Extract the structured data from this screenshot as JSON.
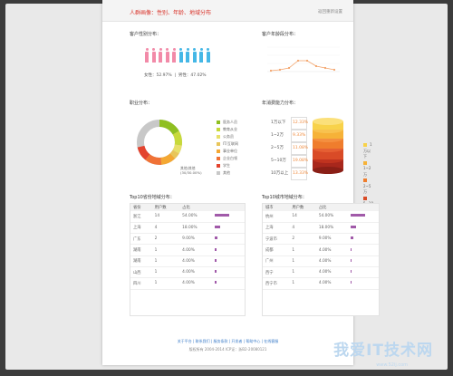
{
  "header": {
    "title": "人群画像：性别、年龄、地域分布",
    "action": "返回重新设置"
  },
  "gender": {
    "title": "客户性别分布：",
    "female_label": "女性：",
    "female_pct": "52.97%",
    "male_label": "男性：",
    "male_pct": "47.02%",
    "female_count": 5,
    "male_count": 5
  },
  "age": {
    "title": "客户年龄段分布："
  },
  "job": {
    "title": "职业分布：",
    "center_label": "其他/其他",
    "center_sub": "(30/30.00%)",
    "items": [
      {
        "label": "医务人员",
        "color": "#8fbf21"
      },
      {
        "label": "教育从业",
        "color": "#c7d93a"
      },
      {
        "label": "公务员",
        "color": "#e8e06a"
      },
      {
        "label": "IT/互联网",
        "color": "#e8c55a"
      },
      {
        "label": "事业单位",
        "color": "#f4a833"
      },
      {
        "label": "企业白领",
        "color": "#f07236"
      },
      {
        "label": "学生",
        "color": "#e3432e"
      },
      {
        "label": "其他",
        "color": "#c8c8c8"
      }
    ]
  },
  "income": {
    "title": "年消费能力分布：",
    "rows": [
      {
        "label": "1万以下",
        "pct": "12.33%",
        "color": "#f8d24a"
      },
      {
        "label": "1~2万",
        "pct": "9.33%",
        "color": "#f6b238"
      },
      {
        "label": "2~5万",
        "pct": "11.08%",
        "color": "#ef7d2d"
      },
      {
        "label": "5~10万",
        "pct": "19.08%",
        "color": "#d94b27"
      },
      {
        "label": "10万以上",
        "pct": "13.33%",
        "color": "#a8271c"
      }
    ]
  },
  "prov": {
    "title": "Top10省份地域分布：",
    "headers": [
      "省份",
      "用户数",
      "占比"
    ],
    "rows": [
      {
        "name": "浙江",
        "count": "14",
        "pct": "54.00%",
        "bar": 18
      },
      {
        "name": "上海",
        "count": "4",
        "pct": "18.00%",
        "bar": 7
      },
      {
        "name": "广东",
        "count": "2",
        "pct": "9.00%",
        "bar": 4
      },
      {
        "name": "湖南",
        "count": "1",
        "pct": "4.00%",
        "bar": 2
      },
      {
        "name": "湖南",
        "count": "1",
        "pct": "4.00%",
        "bar": 2
      },
      {
        "name": "山西",
        "count": "1",
        "pct": "4.00%",
        "bar": 2
      },
      {
        "name": "四川",
        "count": "1",
        "pct": "4.00%",
        "bar": 2
      }
    ]
  },
  "city": {
    "title": "Top10城市地域分布：",
    "headers": [
      "城市",
      "用户数",
      "占比"
    ],
    "rows": [
      {
        "name": "杭州",
        "count": "14",
        "pct": "54.00%",
        "bar": 18
      },
      {
        "name": "上海",
        "count": "4",
        "pct": "18.00%",
        "bar": 7
      },
      {
        "name": "宁波市",
        "count": "2",
        "pct": "9.00%",
        "bar": 4
      },
      {
        "name": "成都",
        "count": "1",
        "pct": "4.00%",
        "bar": 2
      },
      {
        "name": "广州",
        "count": "1",
        "pct": "4.00%",
        "bar": 2
      },
      {
        "name": "西宁",
        "count": "1",
        "pct": "4.00%",
        "bar": 2
      },
      {
        "name": "西宁市",
        "count": "1",
        "pct": "4.00%",
        "bar": 2
      }
    ]
  },
  "footer": {
    "links": "关于平台 | 联系我们 | 服务条款 | 开发者 | 帮助中心 | 在线客服",
    "copyright": "版权所有 2004-2014 ICP证：浙B2-20080121"
  },
  "watermark": {
    "text": "我爱IT技术网",
    "url": "www.52ij.com"
  }
}
